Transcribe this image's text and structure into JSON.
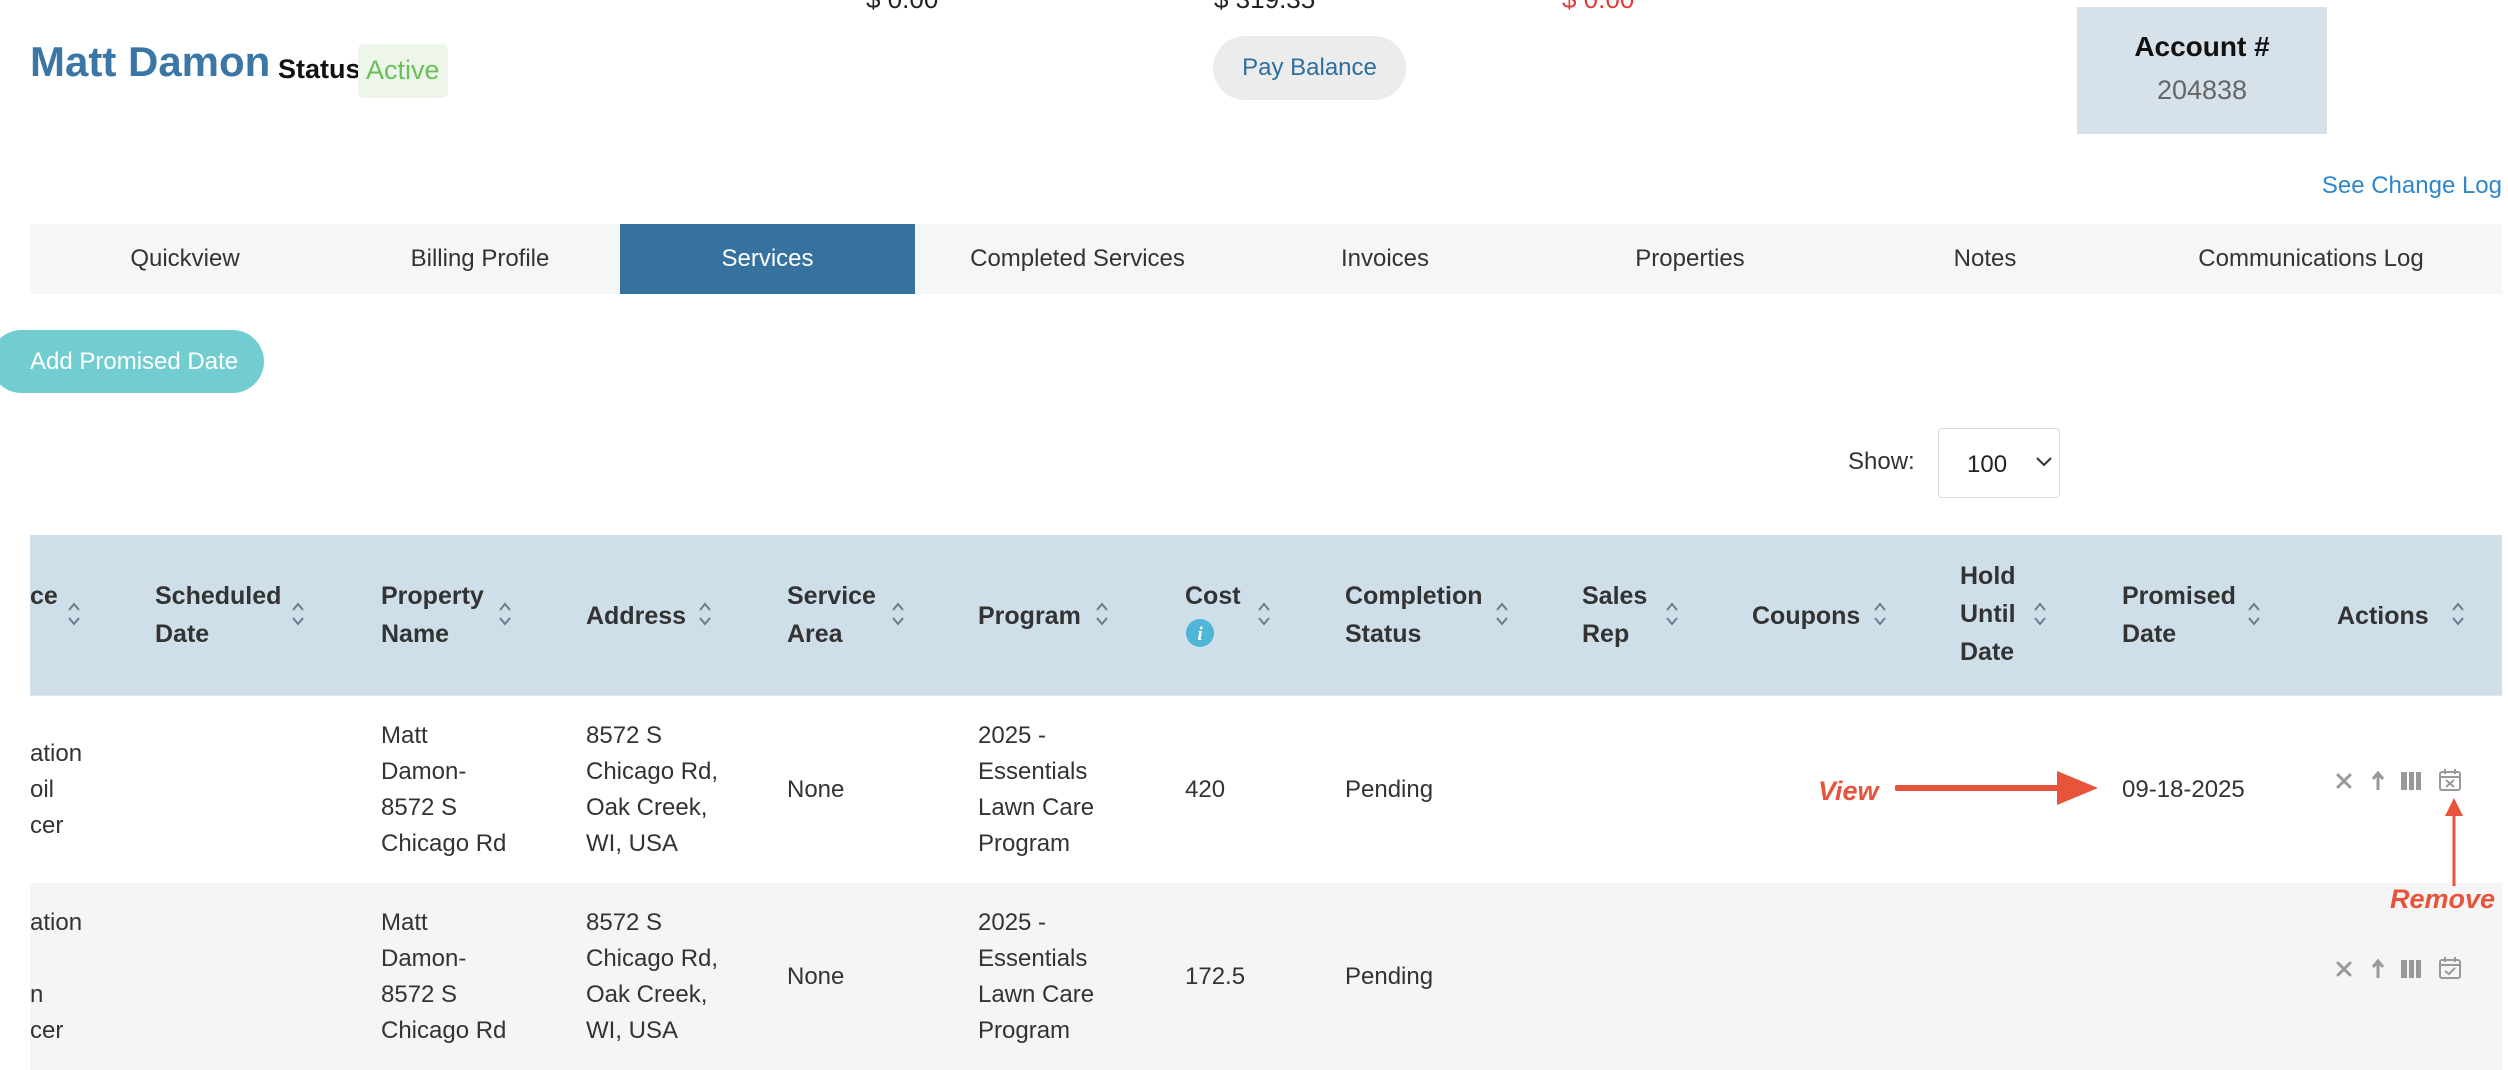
{
  "header": {
    "top_amounts": [
      "$ 0.00",
      "$ 319.35",
      "$ 0.00"
    ],
    "top_amount_colors": [
      "#222222",
      "#222222",
      "#e53935"
    ],
    "customer_name": "Matt Damon",
    "status_label": "Status",
    "status_value": "Active",
    "pay_balance_label": "Pay Balance",
    "account_label": "Account #",
    "account_number": "204838",
    "change_log_link": "See Change Log"
  },
  "tabs": [
    {
      "label": "Quickview",
      "active": false
    },
    {
      "label": "Billing Profile",
      "active": false
    },
    {
      "label": "Services",
      "active": true
    },
    {
      "label": "Completed Services",
      "active": false
    },
    {
      "label": "Invoices",
      "active": false
    },
    {
      "label": "Properties",
      "active": false
    },
    {
      "label": "Notes",
      "active": false
    },
    {
      "label": "Communications Log",
      "active": false
    }
  ],
  "toolbar": {
    "add_promised_date_label": "Add Promised Date",
    "show_label": "Show:",
    "show_value": "100"
  },
  "table": {
    "columns": [
      "ce",
      "Scheduled Date",
      "Property Name",
      "Address",
      "Service Area",
      "Program",
      "Cost",
      "Completion Status",
      "Sales Rep",
      "Coupons",
      "Hold Until Date",
      "Promised Date",
      "Actions"
    ],
    "rows": [
      {
        "service": "ation\noil\ncer",
        "scheduled_date": "",
        "property_name": "Matt\nDamon-\n8572 S\nChicago Rd",
        "address": "8572 S\nChicago Rd,\nOak Creek,\nWI, USA",
        "service_area": "None",
        "program": "2025 -\nEssentials\nLawn Care\nProgram",
        "cost": "420",
        "completion_status": "Pending",
        "sales_rep": "",
        "coupons": "",
        "hold_until_date": "",
        "promised_date": "09-18-2025"
      },
      {
        "service": "ation\n\nn\ncer",
        "scheduled_date": "",
        "property_name": "Matt\nDamon-\n8572 S\nChicago Rd",
        "address": "8572 S\nChicago Rd,\nOak Creek,\nWI, USA",
        "service_area": "None",
        "program": "2025 -\nEssentials\nLawn Care\nProgram",
        "cost": "172.5",
        "completion_status": "Pending",
        "sales_rep": "",
        "coupons": "",
        "hold_until_date": "",
        "promised_date": ""
      }
    ],
    "action_icons": [
      "close-icon",
      "move-icon",
      "pause-icon",
      "calendar-remove-icon"
    ]
  },
  "annotations": {
    "view_label": "View",
    "remove_label": "Remove",
    "color": "#e8533b"
  }
}
